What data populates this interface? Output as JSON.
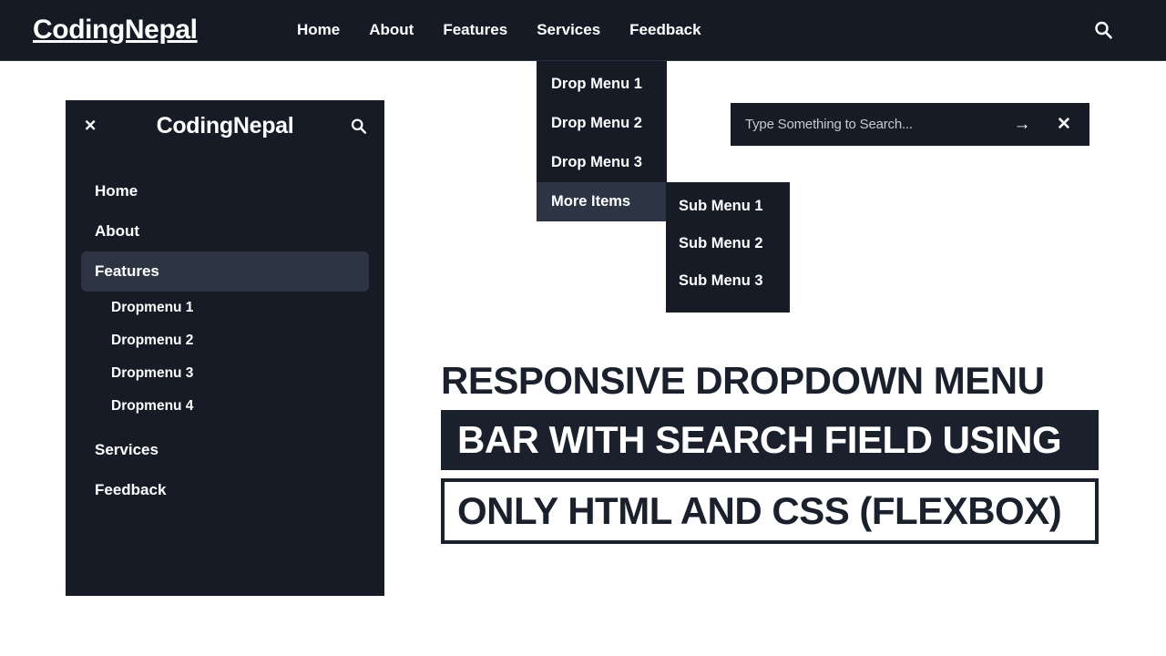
{
  "navbar": {
    "brand": "CodingNepal",
    "links": [
      {
        "label": "Home"
      },
      {
        "label": "About"
      },
      {
        "label": "Features"
      },
      {
        "label": "Services"
      },
      {
        "label": "Feedback"
      }
    ],
    "search_icon": "search-icon",
    "background": "#151a24"
  },
  "dropdown": {
    "items": [
      {
        "label": "Drop Menu 1",
        "active": false
      },
      {
        "label": "Drop Menu 2",
        "active": false
      },
      {
        "label": "Drop Menu 3",
        "active": false
      },
      {
        "label": "More Items",
        "active": true
      }
    ],
    "active_background": "#2d3444",
    "submenu": {
      "items": [
        {
          "label": "Sub Menu 1"
        },
        {
          "label": "Sub Menu 2"
        },
        {
          "label": "Sub Menu 3"
        }
      ]
    }
  },
  "search_box": {
    "value": "",
    "placeholder": "Type Something to Search...",
    "submit_icon": "→",
    "close_icon": "✕"
  },
  "sidebar": {
    "close_icon": "✕",
    "title": "CodingNepal",
    "search_icon": "search-icon",
    "items": [
      {
        "label": "Home"
      },
      {
        "label": "About"
      },
      {
        "label": "Features"
      },
      {
        "label": "Services"
      },
      {
        "label": "Feedback"
      }
    ],
    "submenu": [
      {
        "label": "Dropmenu 1"
      },
      {
        "label": "Dropmenu 2"
      },
      {
        "label": "Dropmenu 3"
      },
      {
        "label": "Dropmenu 4"
      }
    ],
    "active_background": "#2d3444"
  },
  "headline": {
    "line1": "RESPONSIVE DROPDOWN MENU",
    "line2": "BAR WITH SEARCH FIELD USING",
    "line3": "ONLY HTML AND CSS (FLEXBOX)"
  }
}
